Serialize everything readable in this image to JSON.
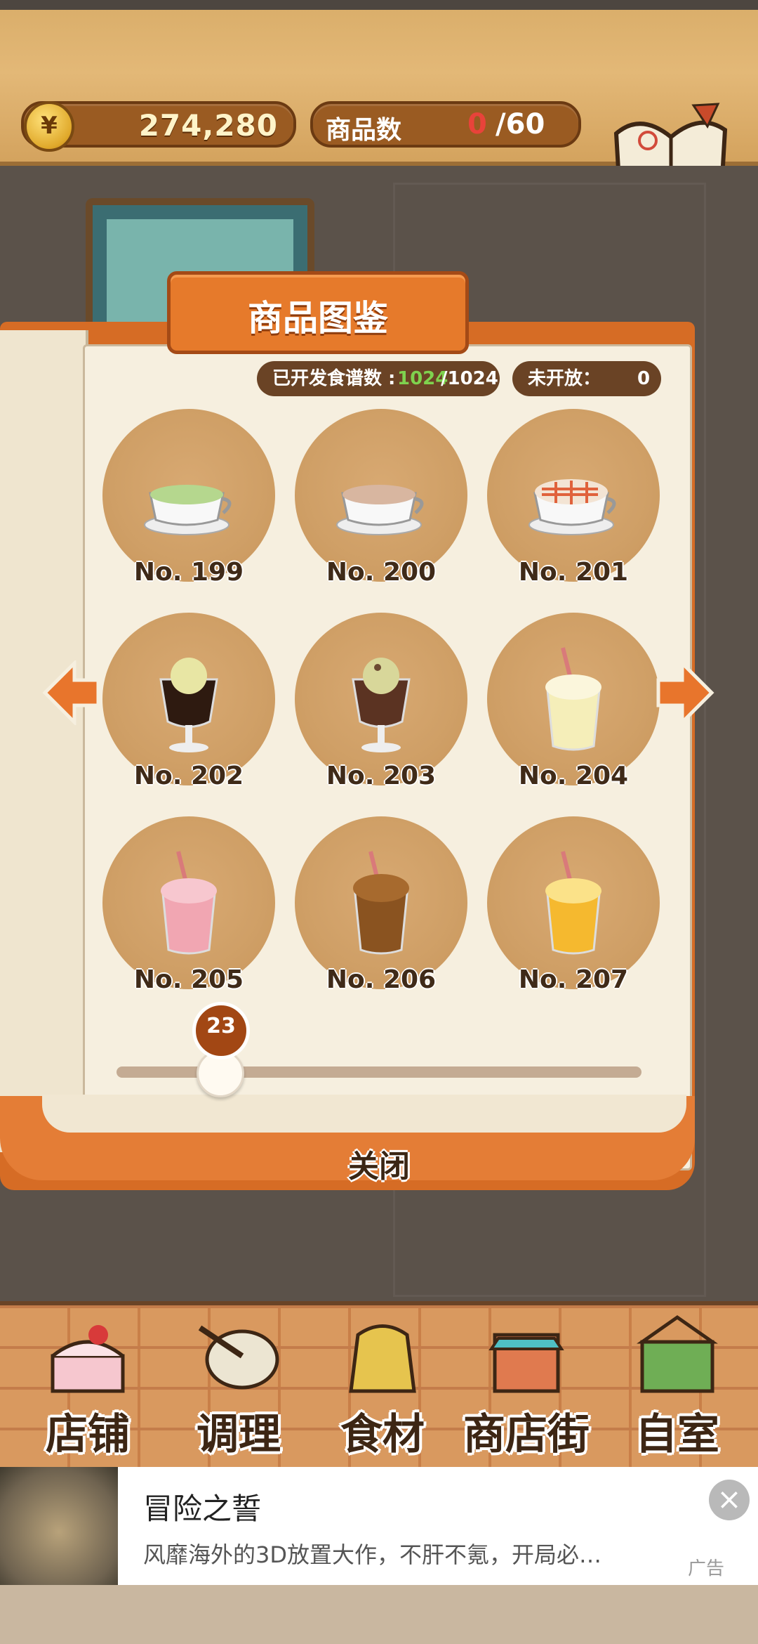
{
  "header": {
    "currency_symbol": "¥",
    "money": "274,280",
    "product_count_label": "商品数",
    "product_count_current": "0",
    "product_count_total": "/60",
    "recipe_button_label": "食谱"
  },
  "catalog": {
    "title": "商品图鉴",
    "developed_label": "已开发食谱数 :",
    "developed_value": "1024",
    "developed_total": "/1024",
    "locked_label": "未开放：",
    "locked_value": "0",
    "items": [
      {
        "label": "No. 199",
        "art": "matcha-latte-cup"
      },
      {
        "label": "No. 200",
        "art": "latte-cup"
      },
      {
        "label": "No. 201",
        "art": "caramel-macchiato-cup"
      },
      {
        "label": "No. 202",
        "art": "coffee-float-glass"
      },
      {
        "label": "No. 203",
        "art": "mocha-float-glass"
      },
      {
        "label": "No. 204",
        "art": "vanilla-frappe"
      },
      {
        "label": "No. 205",
        "art": "strawberry-frappe"
      },
      {
        "label": "No. 206",
        "art": "chocolate-frappe"
      },
      {
        "label": "No. 207",
        "art": "mango-frappe"
      }
    ],
    "page_slider_value": "23",
    "close_label": "关闭"
  },
  "bottom_nav": [
    {
      "label": "店铺",
      "icon": "cake-icon"
    },
    {
      "label": "调理",
      "icon": "mixing-bowl-icon"
    },
    {
      "label": "食材",
      "icon": "flour-sack-icon"
    },
    {
      "label": "商店街",
      "icon": "shop-icon"
    },
    {
      "label": "自室",
      "icon": "staff-only-sign-icon"
    }
  ],
  "ad": {
    "title": "冒险之誓",
    "description": "风靡海外的3D放置大作，不肝不氪，开局必…",
    "tag": "广告"
  }
}
